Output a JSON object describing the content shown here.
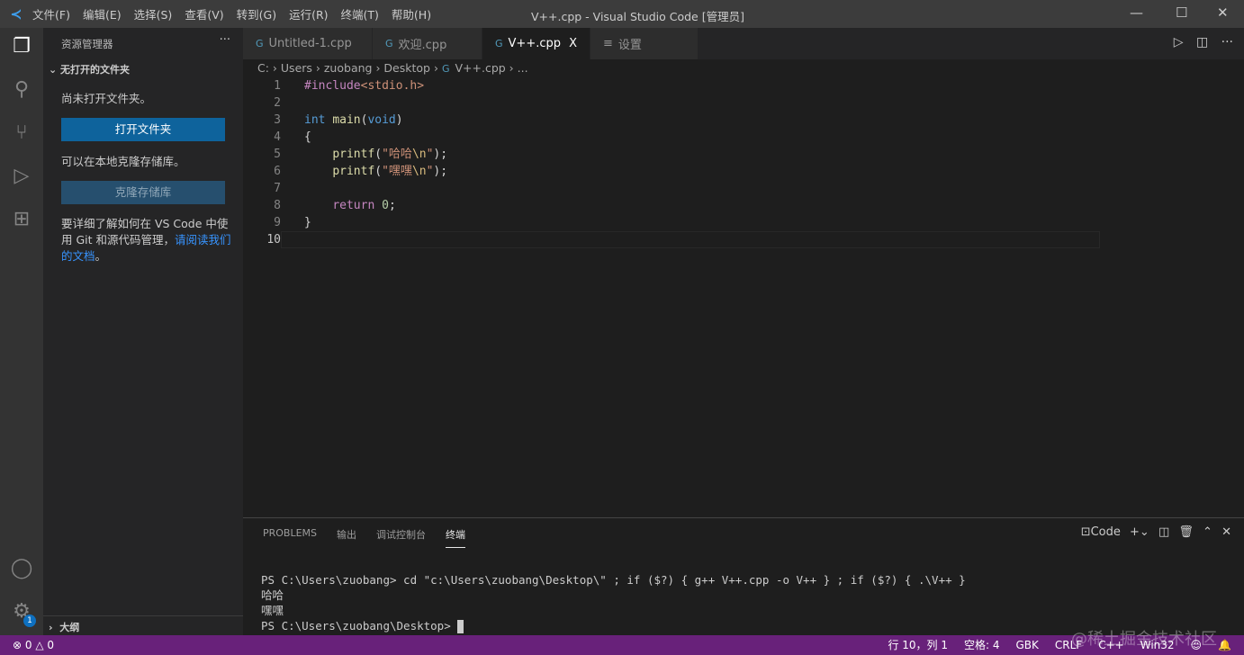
{
  "titlebar": {
    "menu": [
      "文件(F)",
      "编辑(E)",
      "选择(S)",
      "查看(V)",
      "转到(G)",
      "运行(R)",
      "终端(T)",
      "帮助(H)"
    ],
    "title": "V++.cpp - Visual Studio Code [管理员]"
  },
  "activity": {
    "icons": [
      "files-icon",
      "search-icon",
      "source-control-icon",
      "run-debug-icon",
      "extensions-icon",
      "account-icon",
      "settings-gear-icon"
    ],
    "badge": "1"
  },
  "sidebar": {
    "title": "资源管理器",
    "more": "···",
    "section": "无打开的文件夹",
    "no_folder": "尚未打开文件夹。",
    "open_folder": "打开文件夹",
    "clone_hint": "可以在本地克隆存储库。",
    "clone": "克隆存储库",
    "learn_pre": "要详细了解如何在 VS Code 中使用 Git 和源代码管理，",
    "learn_link": "请阅读我们的文档",
    "learn_post": "。",
    "outline": "大纲"
  },
  "tabs": [
    {
      "label": "Untitled-1.cpp"
    },
    {
      "label": "欢迎.cpp"
    },
    {
      "label": "V++.cpp",
      "close": "X"
    },
    {
      "label": "设置"
    }
  ],
  "breadcrumb": [
    "C:",
    "Users",
    "zuobang",
    "Desktop",
    "V++.cpp",
    "..."
  ],
  "editor": {
    "line_numbers": [
      "1",
      "2",
      "3",
      "4",
      "5",
      "6",
      "7",
      "8",
      "9",
      "10"
    ]
  },
  "panel": {
    "tabs": [
      "PROBLEMS",
      "输出",
      "调试控制台",
      "终端"
    ],
    "shell": "Code",
    "terminal": [
      "PS C:\\Users\\zuobang> cd \"c:\\Users\\zuobang\\Desktop\\\" ; if ($?) { g++ V++.cpp -o V++ } ; if ($?) { .\\V++ }",
      "哈哈",
      "嘿嘿",
      "PS C:\\Users\\zuobang\\Desktop> "
    ]
  },
  "status": {
    "errors": "⊗ 0 △ 0",
    "position": "行 10，列 1",
    "spaces": "空格: 4",
    "encoding": "GBK",
    "eol": "CRLF",
    "language": "C++",
    "platform": "Win32"
  },
  "watermark": "@稀土掘金技术社区",
  "colors": {
    "status_bar": "#68217a",
    "button": "#0e639c",
    "accent": "#3794ff"
  }
}
